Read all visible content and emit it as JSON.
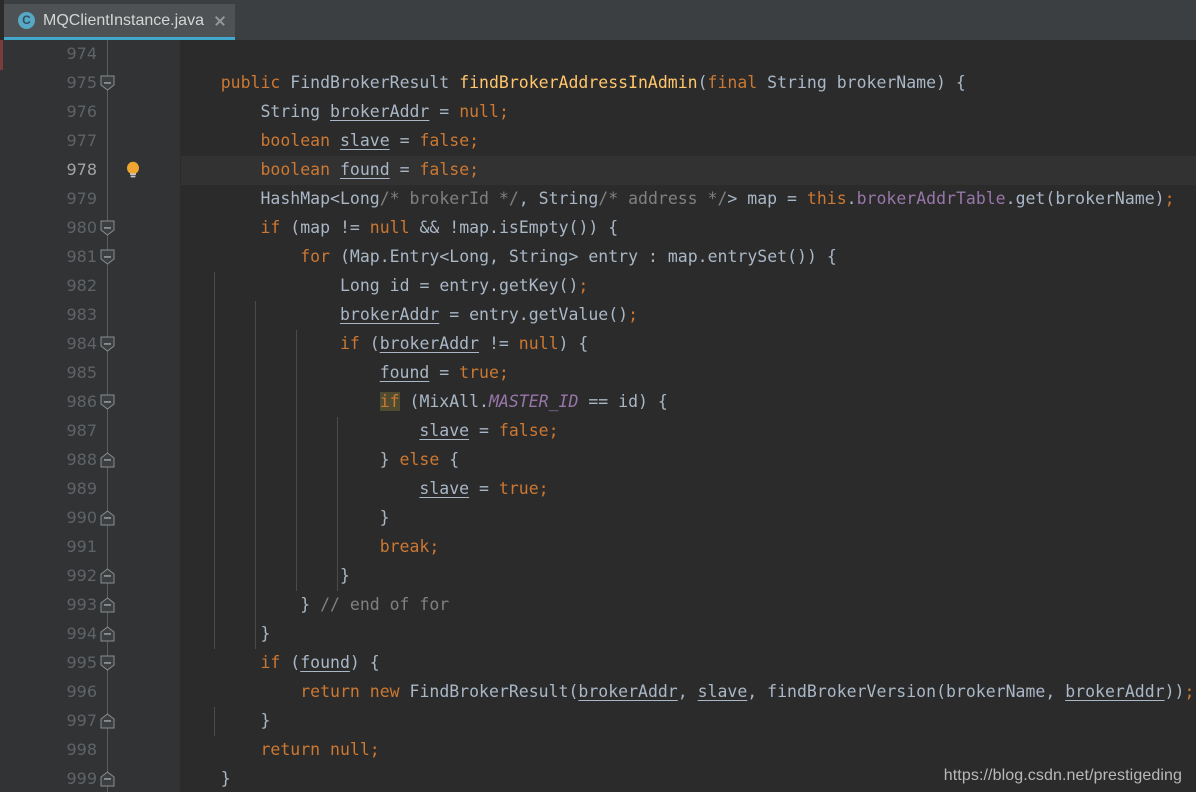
{
  "window": {
    "title": "MQClientInstance.java"
  },
  "tab": {
    "label": "MQClientInstance.java",
    "icon": "java-class-icon",
    "close_icon": "close-icon",
    "accent_color": "#41a7cb"
  },
  "editor": {
    "background_color": "#2b2b2b",
    "gutter_background_color": "#313335",
    "current_line": 978,
    "first_line": 974,
    "last_line": 999,
    "intention_icon": "lightbulb-icon",
    "line_numbers": [
      974,
      975,
      976,
      977,
      978,
      979,
      980,
      981,
      982,
      983,
      984,
      985,
      986,
      987,
      988,
      989,
      990,
      991,
      992,
      993,
      994,
      995,
      996,
      997,
      998,
      999
    ],
    "fold_markers": [
      {
        "line": 975,
        "type": "expanded-open"
      },
      {
        "line": 980,
        "type": "expanded-open"
      },
      {
        "line": 981,
        "type": "expanded-open"
      },
      {
        "line": 984,
        "type": "expanded-open"
      },
      {
        "line": 986,
        "type": "expanded-open"
      },
      {
        "line": 988,
        "type": "expanded-close"
      },
      {
        "line": 990,
        "type": "expanded-close"
      },
      {
        "line": 992,
        "type": "expanded-close"
      },
      {
        "line": 993,
        "type": "expanded-close"
      },
      {
        "line": 994,
        "type": "expanded-close"
      },
      {
        "line": 995,
        "type": "expanded-open"
      },
      {
        "line": 997,
        "type": "expanded-close"
      },
      {
        "line": 999,
        "type": "expanded-close"
      }
    ],
    "lines": [
      {
        "n": 974,
        "text": ""
      },
      {
        "n": 975,
        "text": "    public FindBrokerResult findBrokerAddressInAdmin(final String brokerName) {"
      },
      {
        "n": 976,
        "text": "        String brokerAddr = null;"
      },
      {
        "n": 977,
        "text": "        boolean slave = false;"
      },
      {
        "n": 978,
        "text": "        boolean found = false;"
      },
      {
        "n": 979,
        "text": "        HashMap<Long/* brokerId */, String/* address */> map = this.brokerAddrTable.get(brokerName);"
      },
      {
        "n": 980,
        "text": "        if (map != null && !map.isEmpty()) {"
      },
      {
        "n": 981,
        "text": "            for (Map.Entry<Long, String> entry : map.entrySet()) {"
      },
      {
        "n": 982,
        "text": "                Long id = entry.getKey();"
      },
      {
        "n": 983,
        "text": "                brokerAddr = entry.getValue();"
      },
      {
        "n": 984,
        "text": "                if (brokerAddr != null) {"
      },
      {
        "n": 985,
        "text": "                    found = true;"
      },
      {
        "n": 986,
        "text": "                    if (MixAll.MASTER_ID == id) {"
      },
      {
        "n": 987,
        "text": "                        slave = false;"
      },
      {
        "n": 988,
        "text": "                    } else {"
      },
      {
        "n": 989,
        "text": "                        slave = true;"
      },
      {
        "n": 990,
        "text": "                    }"
      },
      {
        "n": 991,
        "text": "                    break;"
      },
      {
        "n": 992,
        "text": "                }"
      },
      {
        "n": 993,
        "text": "            } // end of for"
      },
      {
        "n": 994,
        "text": "        }"
      },
      {
        "n": 995,
        "text": "        if (found) {"
      },
      {
        "n": 996,
        "text": "            return new FindBrokerResult(brokerAddr, slave, findBrokerVersion(brokerName, brokerAddr));"
      },
      {
        "n": 997,
        "text": "        }"
      },
      {
        "n": 998,
        "text": "        return null;"
      },
      {
        "n": 999,
        "text": "    }"
      }
    ]
  },
  "watermark": {
    "text": "https://blog.csdn.net/prestigeding"
  }
}
